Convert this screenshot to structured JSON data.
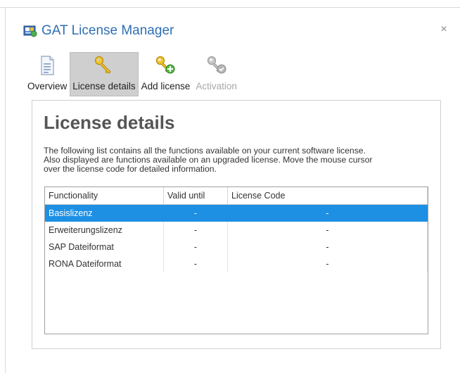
{
  "window": {
    "title": "GAT License Manager",
    "close_glyph": "×",
    "accent_color": "#2f6fb4"
  },
  "toolbar": {
    "items": [
      {
        "label": "Overview",
        "icon": "document-icon",
        "state": "normal"
      },
      {
        "label": "License details",
        "icon": "key-icon",
        "state": "selected"
      },
      {
        "label": "Add license",
        "icon": "key-add-icon",
        "state": "normal"
      },
      {
        "label": "Activation",
        "icon": "key-check-icon",
        "state": "disabled"
      }
    ]
  },
  "panel": {
    "title": "License details",
    "description_lines": [
      "The following list contains all the functions available on your current software license.",
      "Also displayed are functions available on an upgraded license. Move the mouse cursor",
      "over the license code for detailed information."
    ]
  },
  "table": {
    "columns": [
      "Functionality",
      "Valid until",
      "License Code"
    ],
    "rows": [
      {
        "functionality": "Basislizenz",
        "valid_until": "-",
        "license_code": "-",
        "selected": true
      },
      {
        "functionality": "Erweiterungslizenz",
        "valid_until": "-",
        "license_code": "-",
        "selected": false
      },
      {
        "functionality": "SAP Dateiformat",
        "valid_until": "-",
        "license_code": "-",
        "selected": false
      },
      {
        "functionality": "RONA Dateiformat",
        "valid_until": "-",
        "license_code": "-",
        "selected": false
      }
    ],
    "selection_color": "#1e90e4"
  }
}
